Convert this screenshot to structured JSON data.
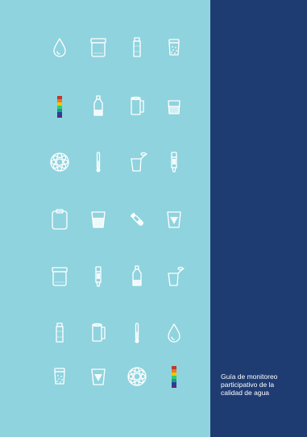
{
  "cover": {
    "title": "Guía de monitoreo\nparticipativo de la\ncalidad de agua",
    "colors": {
      "left_panel": "#8fd3de",
      "right_panel": "#1e3c72",
      "icon_stroke": "#ffffff"
    }
  },
  "icon_grid": [
    [
      "water-drop-icon",
      "sample-jar-icon",
      "small-bottle-icon",
      "sample-cup-dots-icon"
    ],
    [
      "color-scale-strip-icon",
      "water-bottle-icon",
      "paper-towel-roll-icon",
      "beaker-icon"
    ],
    [
      "petri-dish-icon",
      "thermometer-icon",
      "measuring-cup-icon",
      "test-pen-icon"
    ],
    [
      "clipboard-icon",
      "water-cup-icon",
      "test-tube-icon",
      "funnel-filter-icon"
    ],
    [
      "sample-jar-icon",
      "test-pen-icon",
      "water-bottle-icon",
      "measuring-cup-icon"
    ],
    [
      "small-bottle-icon",
      "paper-towel-roll-icon",
      "thermometer-icon",
      "water-drop-icon"
    ],
    [
      "sample-cup-dots-icon",
      "funnel-filter-icon",
      "petri-dish-icon",
      "color-scale-strip-icon"
    ]
  ]
}
